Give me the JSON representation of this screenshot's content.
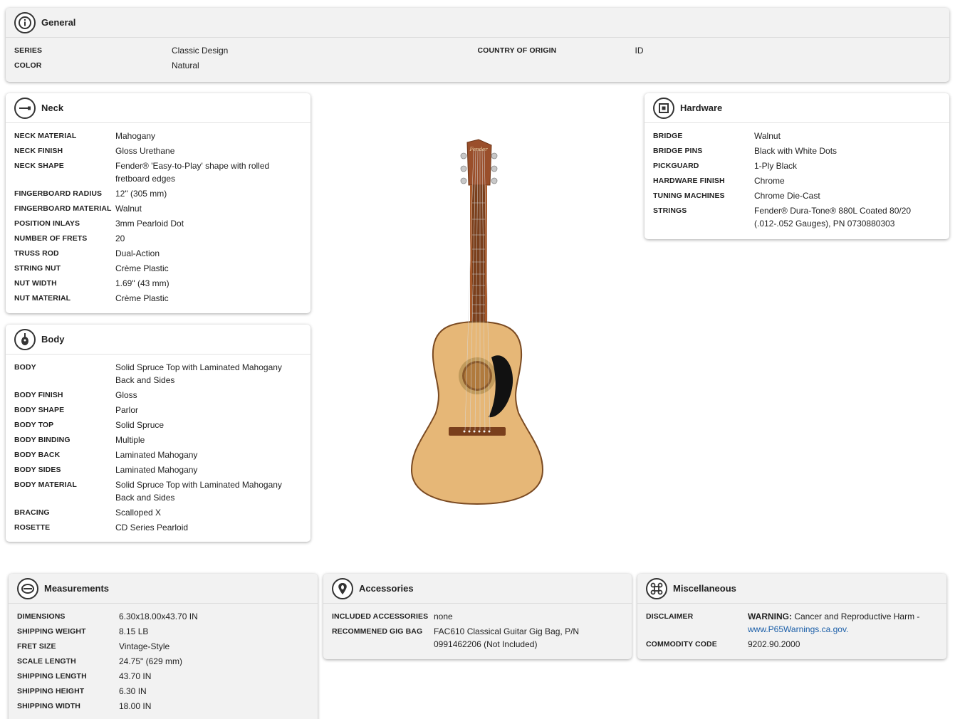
{
  "general": {
    "title": "General",
    "rows_left": [
      {
        "label": "SERIES",
        "value": "Classic Design"
      },
      {
        "label": "COLOR",
        "value": "Natural"
      }
    ],
    "rows_right": [
      {
        "label": "COUNTRY OF ORIGIN",
        "value": "ID"
      }
    ]
  },
  "neck": {
    "title": "Neck",
    "rows": [
      {
        "label": "NECK MATERIAL",
        "value": "Mahogany"
      },
      {
        "label": "NECK FINISH",
        "value": "Gloss Urethane"
      },
      {
        "label": "NECK SHAPE",
        "value": "Fender® 'Easy-to-Play' shape with rolled fretboard edges"
      },
      {
        "label": "FINGERBOARD RADIUS",
        "value": "12\" (305 mm)"
      },
      {
        "label": "FINGERBOARD MATERIAL",
        "value": "Walnut"
      },
      {
        "label": "POSITION INLAYS",
        "value": "3mm Pearloid Dot"
      },
      {
        "label": "NUMBER OF FRETS",
        "value": "20"
      },
      {
        "label": "TRUSS ROD",
        "value": "Dual-Action"
      },
      {
        "label": "STRING NUT",
        "value": "Crème Plastic"
      },
      {
        "label": "NUT WIDTH",
        "value": "1.69\" (43 mm)"
      },
      {
        "label": "NUT MATERIAL",
        "value": "Crème Plastic"
      }
    ]
  },
  "body": {
    "title": "Body",
    "rows": [
      {
        "label": "BODY",
        "value": "Solid Spruce Top with Laminated Mahogany Back and Sides"
      },
      {
        "label": "BODY FINISH",
        "value": "Gloss"
      },
      {
        "label": "BODY SHAPE",
        "value": "Parlor"
      },
      {
        "label": "BODY TOP",
        "value": "Solid Spruce"
      },
      {
        "label": "BODY BINDING",
        "value": "Multiple"
      },
      {
        "label": "BODY BACK",
        "value": "Laminated Mahogany"
      },
      {
        "label": "BODY SIDES",
        "value": "Laminated Mahogany"
      },
      {
        "label": "BODY MATERIAL",
        "value": "Solid Spruce Top with Laminated Mahogany Back and Sides"
      },
      {
        "label": "BRACING",
        "value": "Scalloped X"
      },
      {
        "label": "ROSETTE",
        "value": "CD Series Pearloid"
      }
    ]
  },
  "hardware": {
    "title": "Hardware",
    "rows": [
      {
        "label": "BRIDGE",
        "value": "Walnut"
      },
      {
        "label": "BRIDGE PINS",
        "value": "Black with White Dots"
      },
      {
        "label": "PICKGUARD",
        "value": "1-Ply Black"
      },
      {
        "label": "HARDWARE FINISH",
        "value": "Chrome"
      },
      {
        "label": "TUNING MACHINES",
        "value": "Chrome Die-Cast"
      },
      {
        "label": "STRINGS",
        "value": "Fender® Dura-Tone® 880L Coated 80/20 (.012-.052 Gauges), PN 0730880303"
      }
    ]
  },
  "measurements": {
    "title": "Measurements",
    "rows": [
      {
        "label": "DIMENSIONS",
        "value": "6.30x18.00x43.70 IN"
      },
      {
        "label": "SHIPPING WEIGHT",
        "value": "8.15 LB"
      },
      {
        "label": "FRET SIZE",
        "value": "Vintage-Style"
      },
      {
        "label": "SCALE LENGTH",
        "value": "24.75\" (629 mm)"
      },
      {
        "label": "SHIPPING LENGTH",
        "value": "43.70 IN"
      },
      {
        "label": "SHIPPING HEIGHT",
        "value": "6.30 IN"
      },
      {
        "label": "SHIPPING WIDTH",
        "value": "18.00 IN"
      }
    ]
  },
  "accessories": {
    "title": "Accessories",
    "rows": [
      {
        "label": "INCLUDED ACCESSORIES",
        "value": "none"
      },
      {
        "label": "RECOMMENED GIG BAG",
        "value": "FAC610 Classical Guitar Gig Bag, P/N 0991462206 (Not Included)"
      }
    ]
  },
  "misc": {
    "title": "Miscellaneous",
    "disclaimer_label": "DISCLAIMER",
    "disclaimer_bold": "WARNING:",
    "disclaimer_text": " Cancer and Reproductive Harm -",
    "disclaimer_link": "www.P65Warnings.ca.gov.",
    "commodity_label": "COMMODITY CODE",
    "commodity_value": "9202.90.2000"
  },
  "icons": {
    "general": "info-icon",
    "neck": "neck-icon",
    "body": "guitar-body-icon",
    "hardware": "hardware-icon",
    "measurements": "tape-measure-icon",
    "accessories": "pick-icon",
    "misc": "command-icon"
  },
  "colors": {
    "link": "#1a5ea8",
    "grey_card": "#f2f2f2",
    "guitar_top": "#e6b777",
    "pickguard": "#111111"
  }
}
